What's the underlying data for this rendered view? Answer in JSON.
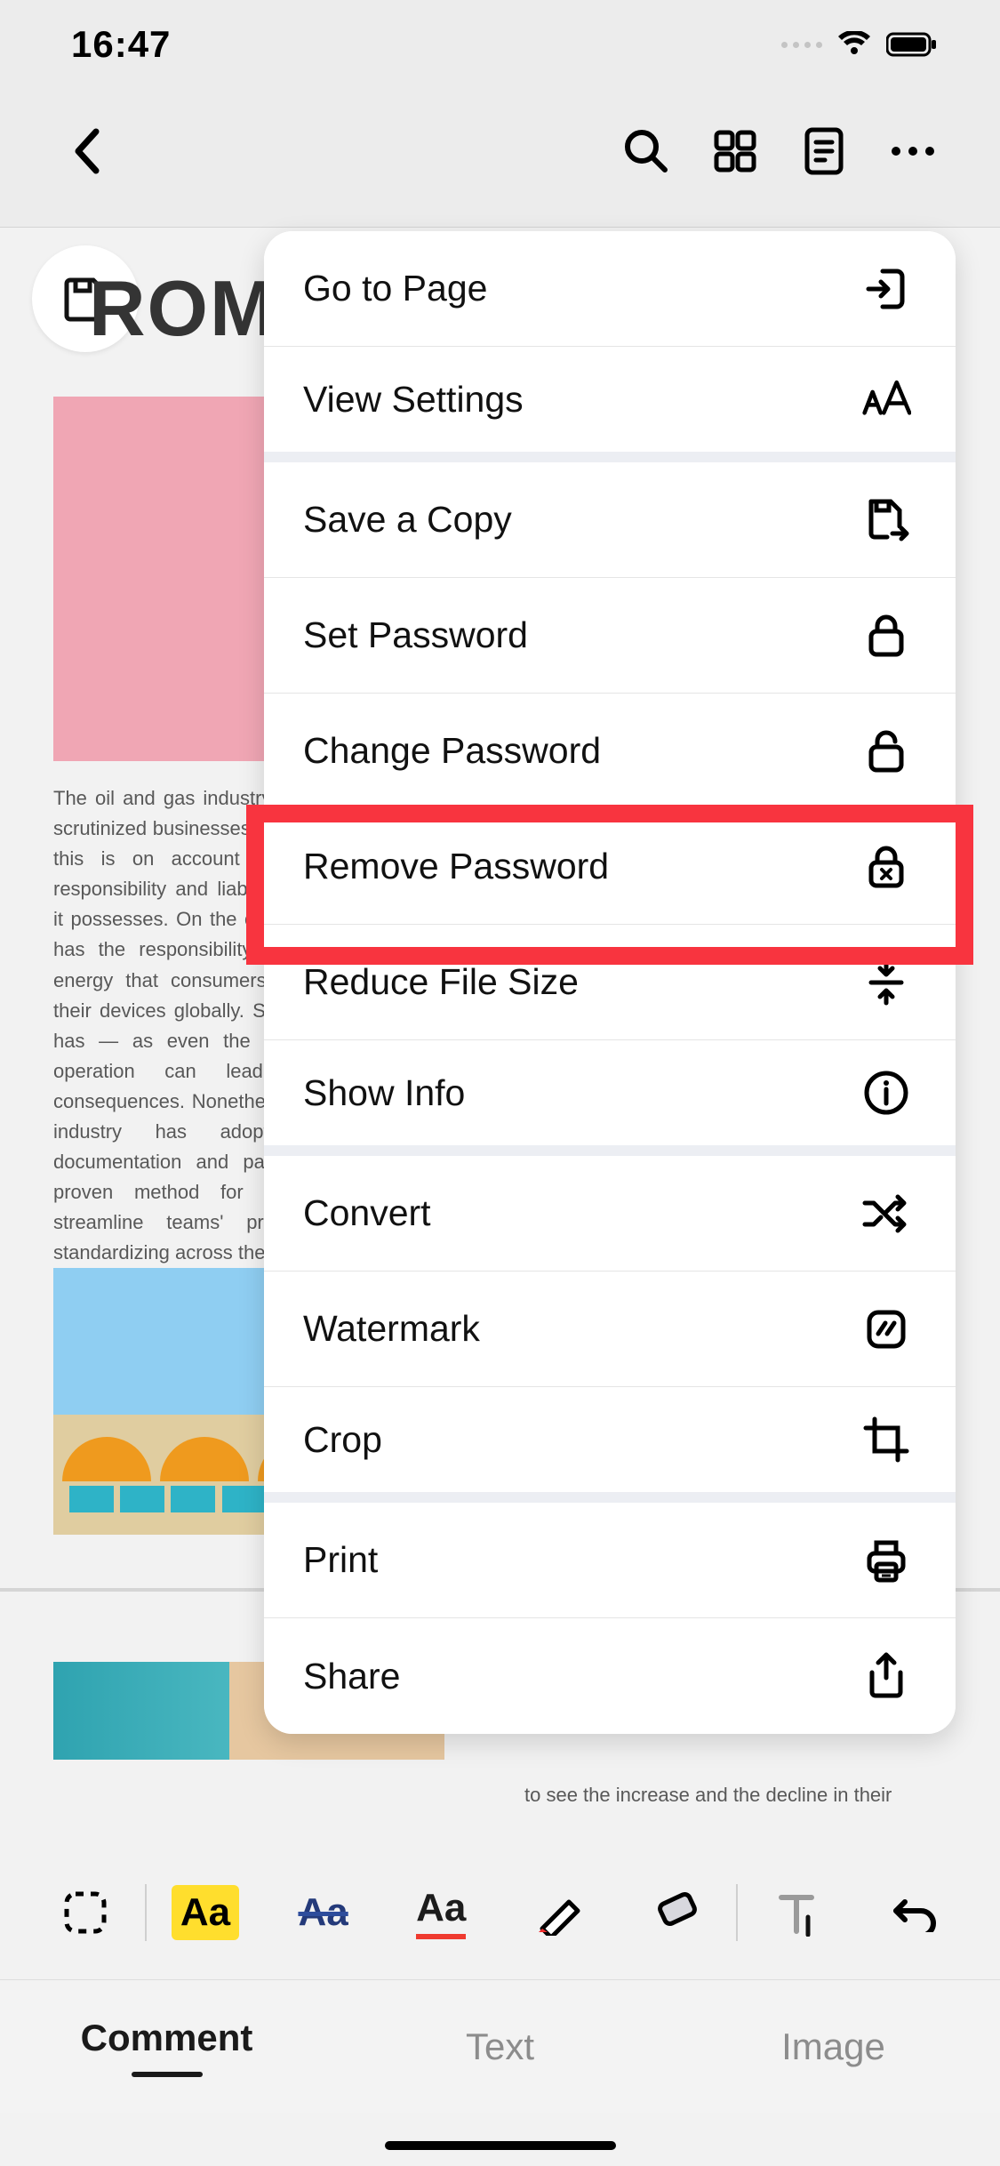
{
  "status": {
    "time": "16:47"
  },
  "doc": {
    "heading_fragment": "ROM",
    "paragraph": "The oil and gas industry is one of the most scrutinized businesses in the world. Primarily this is on account of two reasons — responsibility and liability. The responsibility it possesses. On the one hand, the industry has the responsibility to produce enough energy that consumers will use to power their devices globally. Second, the liability it has — as even the slightest blunder in operation can lead to catastrophic consequences. Nonetheless, the oil and gas industry has adopted a standard documentation and paperwork. This is a proven method for this paperwork to streamline teams' productivity and by standardizing across the industry.",
    "decline_fragment": "to see the increase and the decline in their"
  },
  "menu": {
    "items": [
      {
        "label": "Go to Page",
        "icon": "enter-page-icon"
      },
      {
        "label": "View Settings",
        "icon": "text-size-icon"
      },
      {
        "label": "Save a Copy",
        "icon": "save-export-icon"
      },
      {
        "label": "Set Password",
        "icon": "lock-closed-icon"
      },
      {
        "label": "Change Password",
        "icon": "lock-open-icon"
      },
      {
        "label": "Remove Password",
        "icon": "lock-x-icon"
      },
      {
        "label": "Reduce File Size",
        "icon": "compress-icon"
      },
      {
        "label": "Show Info",
        "icon": "info-icon"
      },
      {
        "label": "Convert",
        "icon": "shuffle-icon"
      },
      {
        "label": "Watermark",
        "icon": "watermark-icon"
      },
      {
        "label": "Crop",
        "icon": "crop-icon"
      },
      {
        "label": "Print",
        "icon": "print-icon"
      },
      {
        "label": "Share",
        "icon": "share-icon"
      }
    ]
  },
  "toolbar": {
    "highlight_sample": "Aa",
    "strike_sample": "Aa",
    "underline_sample": "Aa"
  },
  "tabs": {
    "comment": "Comment",
    "text": "Text",
    "image": "Image"
  }
}
